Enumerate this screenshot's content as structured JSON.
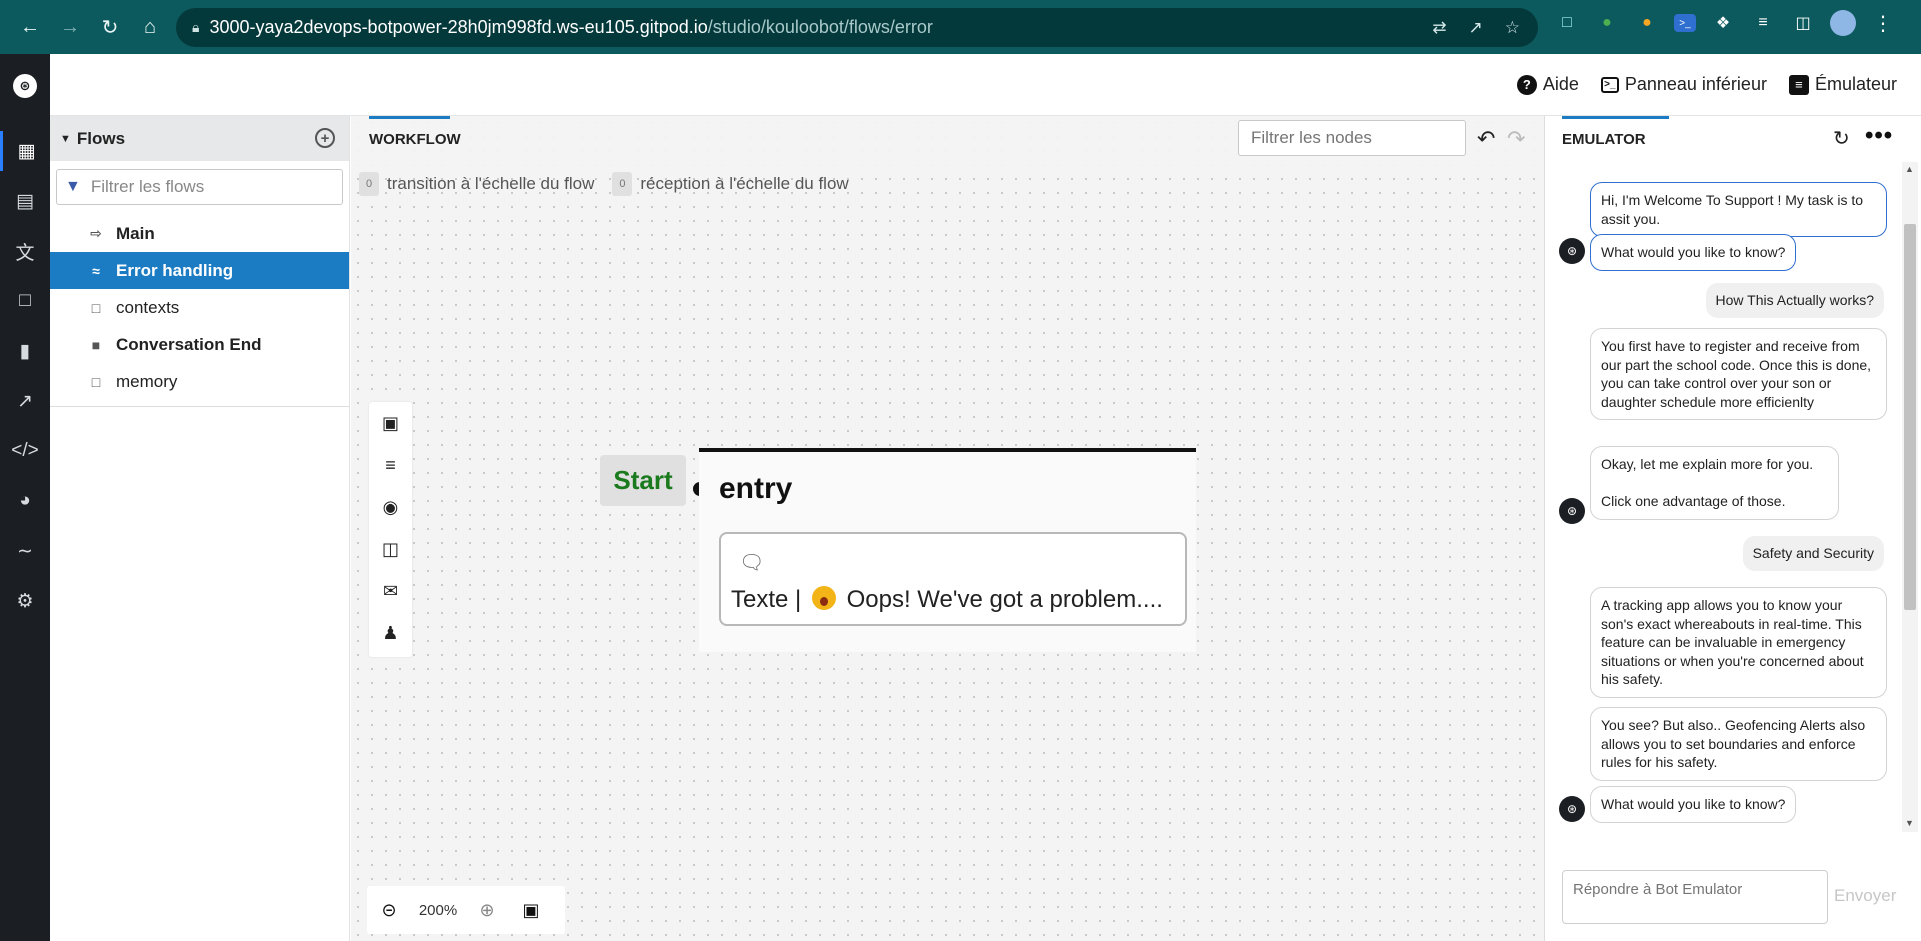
{
  "browser": {
    "url_host": "3000-yaya2devops-botpower-28h0jm998fd.ws-eu105.gitpod.io",
    "url_path": "/studio/kouloobot/flows/error"
  },
  "topbar": {
    "help": "Aide",
    "bottom_panel": "Panneau inférieur",
    "emulator": "Émulateur"
  },
  "flows_panel": {
    "title": "Flows",
    "filter_placeholder": "Filtrer les flows",
    "items": [
      {
        "label": "Main",
        "icon": "arrow-enter-icon"
      },
      {
        "label": "Error handling",
        "icon": "graph-icon"
      },
      {
        "label": "contexts",
        "icon": "file-icon"
      },
      {
        "label": "Conversation End",
        "icon": "square-icon"
      },
      {
        "label": "memory",
        "icon": "file-icon"
      }
    ]
  },
  "workflow": {
    "tab": "WORKFLOW",
    "node_filter_placeholder": "Filtrer les nodes",
    "transitions_count": "0",
    "transitions_label": "transition à l'échelle du flow",
    "receptions_count": "0",
    "receptions_label": "réception à l'échelle du flow",
    "start_label": "Start",
    "node": {
      "title": "entry",
      "content_prefix": "Texte |",
      "content_text": "Oops! We've got a problem...."
    },
    "zoom": "200%"
  },
  "emulator": {
    "title": "EMULATOR",
    "messages": [
      {
        "from": "bot",
        "text": "Hi, I'm Welcome To Support ! My task is to assit you."
      },
      {
        "from": "bot",
        "text": "What would you like to know?"
      },
      {
        "from": "user",
        "text": "How This Actually works?"
      },
      {
        "from": "bot",
        "text": "You first have to register and receive from our part the school code. Once this is done, you can take control over your son or daughter schedule more efficienlty"
      },
      {
        "from": "bot",
        "text": "Okay, let me explain more for you.\n\nClick one advantage of those."
      },
      {
        "from": "user",
        "text": "Safety and Security"
      },
      {
        "from": "bot",
        "text": "A tracking app allows you to know your son's exact whereabouts in real-time. This feature can be invaluable in emergency situations or when you're concerned about his safety."
      },
      {
        "from": "bot",
        "text": "You see? But also.. Geofencing Alerts also allows you to set boundaries and enforce rules for his safety."
      },
      {
        "from": "bot",
        "text": "What would you like to know?"
      }
    ],
    "reply_placeholder": "Répondre à Bot Emulator",
    "send": "Envoyer"
  }
}
